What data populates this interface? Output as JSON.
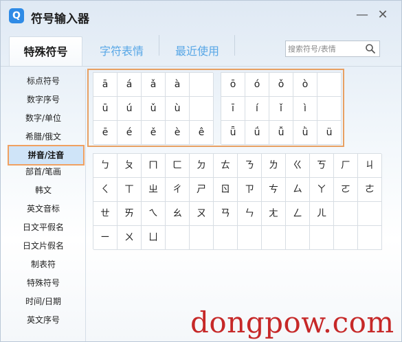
{
  "window": {
    "logo": "Q",
    "title": "符号输入器",
    "min_label": "—",
    "close_label": "✕"
  },
  "tabs": [
    {
      "label": "特殊符号",
      "active": true
    },
    {
      "label": "字符表情",
      "active": false
    },
    {
      "label": "最近使用",
      "active": false
    }
  ],
  "search": {
    "placeholder": "搜索符号/表情",
    "icon": "search-icon"
  },
  "sidebar": {
    "items": [
      {
        "label": "标点符号"
      },
      {
        "label": "数字序号"
      },
      {
        "label": "数字/单位"
      },
      {
        "label": "希腊/俄文"
      },
      {
        "label": "拼音/注音",
        "active": true
      },
      {
        "label": "部首/笔画"
      },
      {
        "label": "韩文"
      },
      {
        "label": "英文音标"
      },
      {
        "label": "日文平假名"
      },
      {
        "label": "日文片假名"
      },
      {
        "label": "制表符"
      },
      {
        "label": "特殊符号"
      },
      {
        "label": "时间/日期"
      },
      {
        "label": "英文序号"
      }
    ]
  },
  "pinyin_groups": [
    {
      "rows": [
        [
          "ā",
          "á",
          "ǎ",
          "à",
          ""
        ],
        [
          "ū",
          "ú",
          "ǔ",
          "ù",
          ""
        ],
        [
          "ē",
          "é",
          "ě",
          "è",
          "ê"
        ]
      ]
    },
    {
      "rows": [
        [
          "ō",
          "ó",
          "ǒ",
          "ò",
          ""
        ],
        [
          "ī",
          "í",
          "ǐ",
          "ì",
          ""
        ],
        [
          "ǖ",
          "ǘ",
          "ǚ",
          "ǜ",
          "ü"
        ]
      ]
    }
  ],
  "zhuyin_rows": [
    [
      "ㄅ",
      "ㄆ",
      "ㄇ",
      "ㄈ",
      "ㄉ",
      "ㄊ",
      "ㄋ",
      "ㄌ",
      "ㄍ",
      "ㄎ",
      "ㄏ",
      "ㄐ"
    ],
    [
      "ㄑ",
      "ㄒ",
      "ㄓ",
      "ㄔ",
      "ㄕ",
      "ㄖ",
      "ㄗ",
      "ㄘ",
      "ㄙ",
      "ㄚ",
      "ㄛ",
      "ㄜ"
    ],
    [
      "ㄝ",
      "ㄞ",
      "ㄟ",
      "ㄠ",
      "ㄡ",
      "ㄢ",
      "ㄣ",
      "ㄤ",
      "ㄥ",
      "ㄦ",
      "",
      ""
    ],
    [
      "ㄧ",
      "ㄨ",
      "ㄩ",
      "",
      "",
      "",
      "",
      "",
      "",
      "",
      "",
      ""
    ]
  ],
  "watermark": "dongpow.com",
  "colors": {
    "accent": "#2f8be6",
    "highlight": "#e8a062",
    "selected_bg": "#cfe4f8",
    "watermark": "#c62828"
  }
}
